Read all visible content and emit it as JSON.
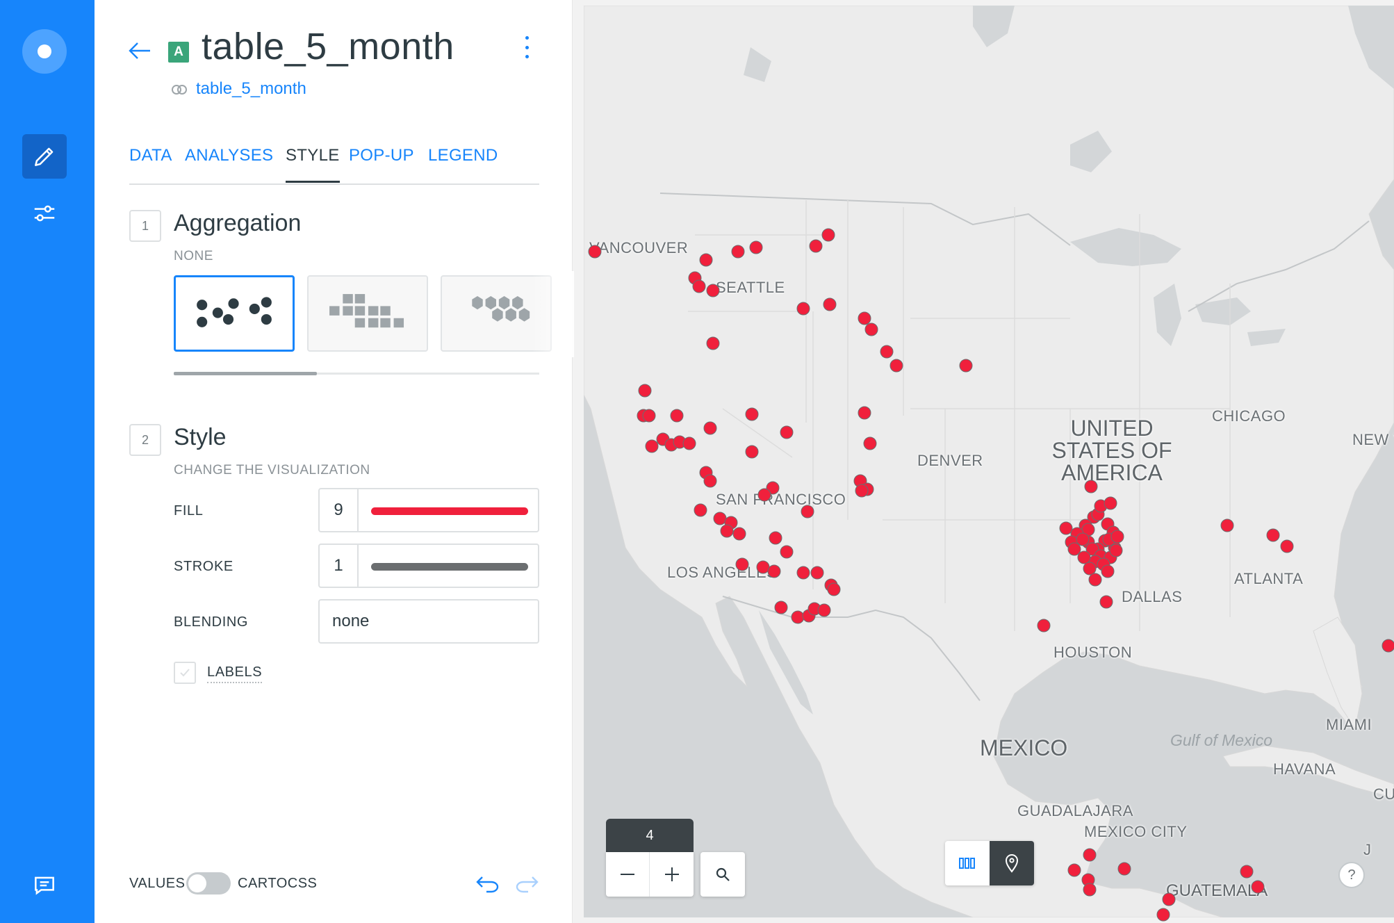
{
  "layer": {
    "letter": "A",
    "title": "table_5_month",
    "source": "table_5_month"
  },
  "tabs": [
    {
      "label": "DATA",
      "active": false
    },
    {
      "label": "ANALYSES",
      "active": false
    },
    {
      "label": "STYLE",
      "active": true
    },
    {
      "label": "POP-UP",
      "active": false
    },
    {
      "label": "LEGEND",
      "active": false
    }
  ],
  "aggregation": {
    "step": "1",
    "title": "Aggregation",
    "selected": "NONE",
    "options": [
      "points",
      "squares",
      "hexabins"
    ]
  },
  "style": {
    "step": "2",
    "title": "Style",
    "subtitle": "CHANGE THE VISUALIZATION",
    "fill": {
      "label": "FILL",
      "value": "9",
      "color": "#f0203c"
    },
    "stroke": {
      "label": "STROKE",
      "value": "1",
      "color": "#6b6e70"
    },
    "blending": {
      "label": "BLENDING",
      "value": "none"
    },
    "labels": {
      "label": "LABELS",
      "checked": false
    }
  },
  "footer": {
    "values_label": "VALUES",
    "cartocss_label": "CARTOCSS",
    "cartocss_enabled": false
  },
  "map": {
    "zoom": "4",
    "labels": {
      "vancouver": "VANCOUVER",
      "seattle": "SEATTLE",
      "san_francisco": "SAN FRANCISCO",
      "los_angeles": "LOS ANGELES",
      "denver": "DENVER",
      "dallas": "DALLAS",
      "houston": "HOUSTON",
      "chicago": "CHICAGO",
      "atlanta": "ATLANTA",
      "new_york": "NEW Y",
      "miami": "MIAMI",
      "havana": "HAVANA",
      "cuba": "CU",
      "guadalajara": "GUADALAJARA",
      "mexico_city": "MEXICO CITY",
      "guatemala": "GUATEMALA",
      "usa_line1": "UNITED",
      "usa_line2": "STATES OF",
      "usa_line3": "AMERICA",
      "mexico": "MEXICO",
      "gulf": "Gulf of Mexico",
      "jamaica": "J"
    },
    "point_color": "#f0203c",
    "help": "?"
  }
}
